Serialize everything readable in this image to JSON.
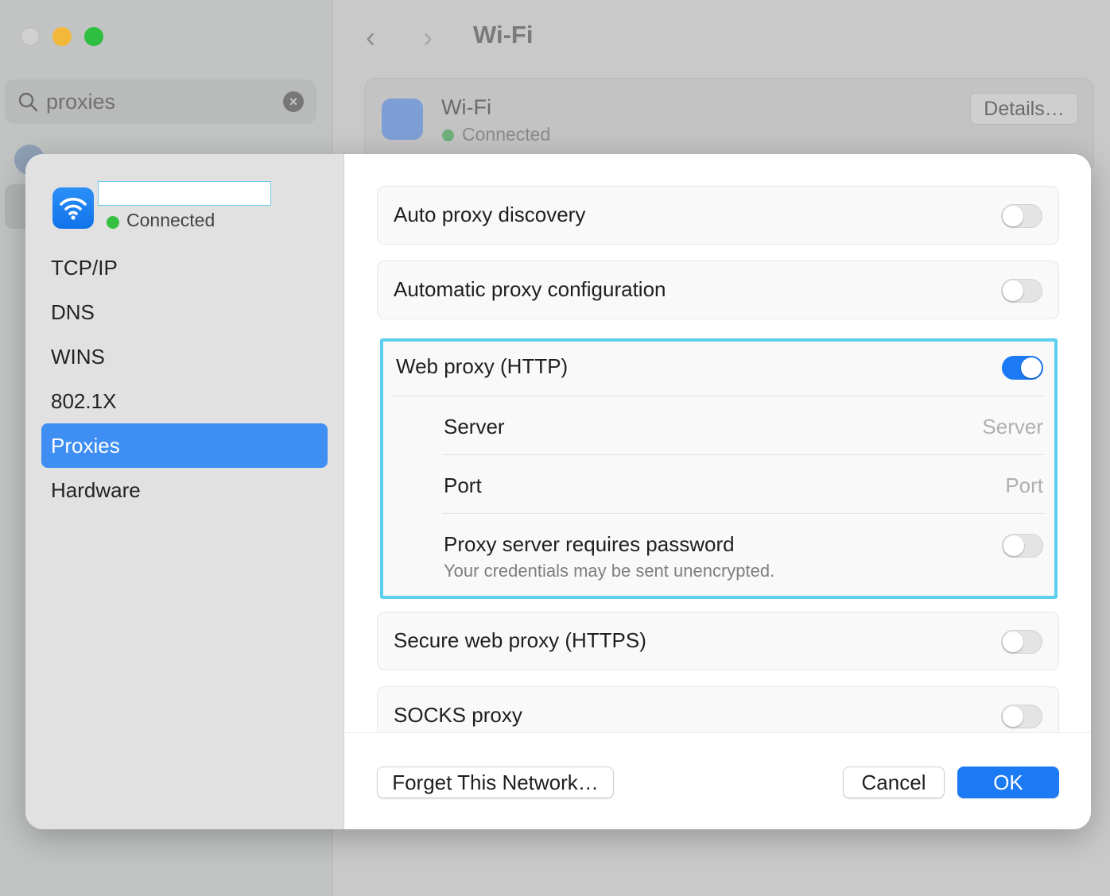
{
  "background_window": {
    "search": {
      "query": "proxies"
    },
    "title": "Wi-Fi",
    "nav": {
      "back": "‹",
      "forward": "›"
    },
    "network_card": {
      "name": "Wi-Fi",
      "status": "Connected",
      "details_label": "Details…"
    }
  },
  "sheet": {
    "network": {
      "name": "",
      "status": "Connected"
    },
    "sidebar": {
      "items": [
        {
          "label": "TCP/IP"
        },
        {
          "label": "DNS"
        },
        {
          "label": "WINS"
        },
        {
          "label": "802.1X"
        },
        {
          "label": "Proxies",
          "selected": true
        },
        {
          "label": "Hardware"
        }
      ]
    },
    "proxies": {
      "auto_discovery": {
        "label": "Auto proxy discovery",
        "enabled": false
      },
      "auto_config": {
        "label": "Automatic proxy configuration",
        "enabled": false
      },
      "web_http": {
        "label": "Web proxy (HTTP)",
        "enabled": true,
        "server": {
          "label": "Server",
          "placeholder": "Server"
        },
        "port": {
          "label": "Port",
          "placeholder": "Port"
        },
        "password": {
          "label": "Proxy server requires password",
          "note": "Your credentials may be sent unencrypted.",
          "enabled": false
        }
      },
      "secure_https": {
        "label": "Secure web proxy (HTTPS)",
        "enabled": false
      },
      "socks": {
        "label": "SOCKS proxy",
        "enabled": false
      }
    },
    "footer": {
      "forget_label": "Forget This Network…",
      "cancel_label": "Cancel",
      "ok_label": "OK"
    }
  },
  "colors": {
    "accent": "#1b7af4",
    "selected_sidebar": "#3e8ef3",
    "highlight_outline": "#5bd0ee",
    "connected_dot": "#35c042"
  }
}
